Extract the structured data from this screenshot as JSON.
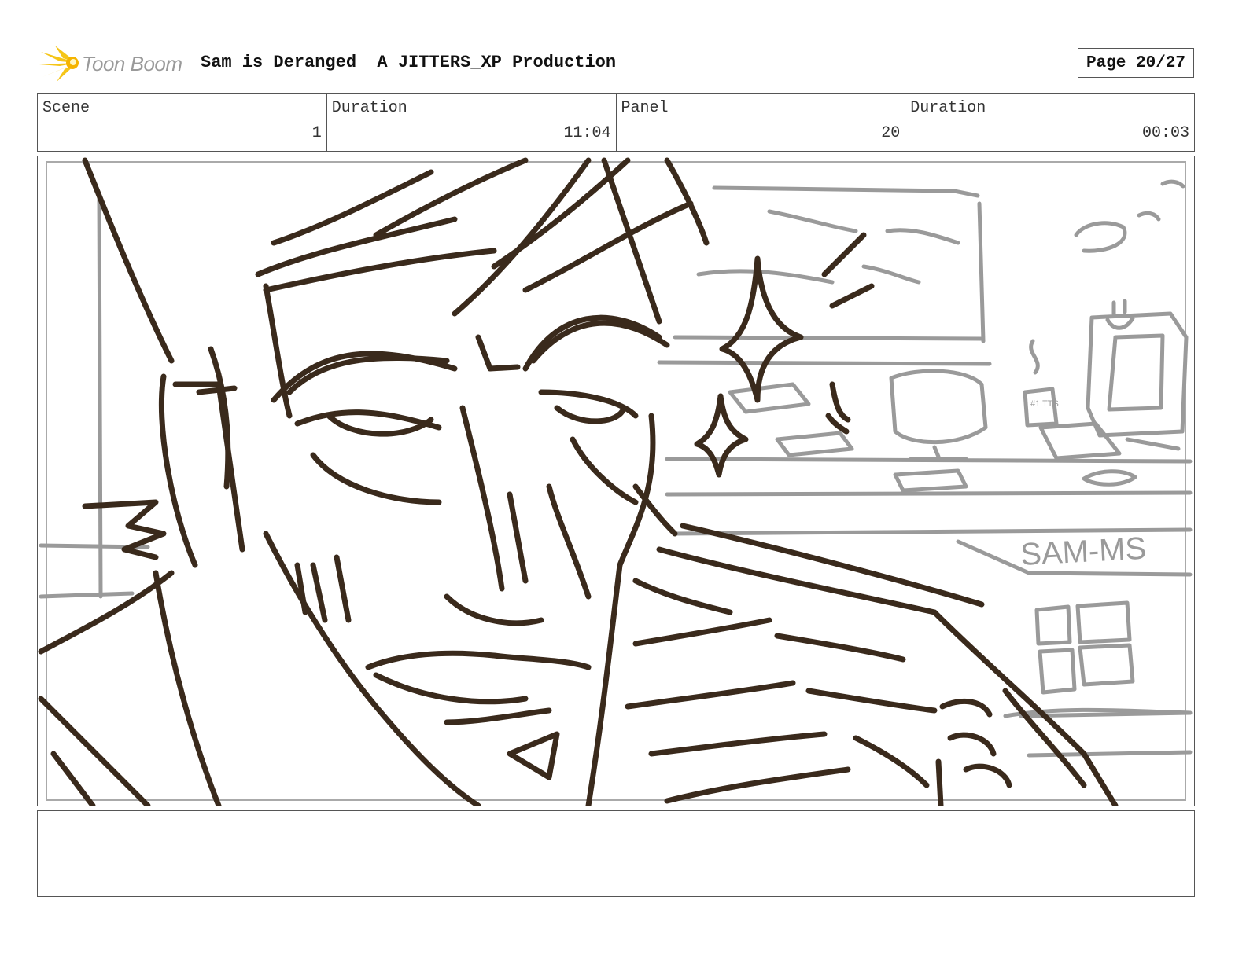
{
  "header": {
    "logo_text": "Toon Boom",
    "title": "Sam is Deranged  A JITTERS_XP Production",
    "page": "Page 20/27"
  },
  "info": {
    "scene_label": "Scene",
    "scene_value": "1",
    "scene_duration_label": "Duration",
    "scene_duration_value": "11:04",
    "panel_label": "Panel",
    "panel_value": "20",
    "panel_duration_label": "Duration",
    "panel_duration_value": "00:03"
  },
  "panel_art": {
    "background_sign": "SAM-MS",
    "mug_text": "#1 TTS",
    "line_color_foreground": "#3a2a1c",
    "line_color_background": "#9a9a9a"
  },
  "notes": {
    "text": ""
  }
}
